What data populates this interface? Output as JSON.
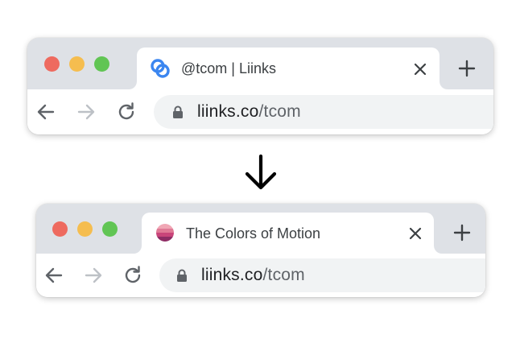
{
  "browser_before": {
    "tab": {
      "title": "@tcom | Liinks",
      "favicon": "liinks-logo-icon"
    },
    "address": {
      "host": "liinks.co",
      "path": "/tcom"
    }
  },
  "transition_icon": "arrow-down-icon",
  "browser_after": {
    "tab": {
      "title": "The Colors of Motion",
      "favicon": "color-stripes-icon"
    },
    "address": {
      "host": "liinks.co",
      "path": "/tcom"
    }
  },
  "colors": {
    "tabbar": "#dee1e6",
    "omnibox": "#f1f3f4",
    "close_red": "#ee6a5f",
    "minimize_yellow": "#f5bd4f",
    "zoom_green": "#61c554",
    "liinks_blue": "#3b86f0"
  }
}
